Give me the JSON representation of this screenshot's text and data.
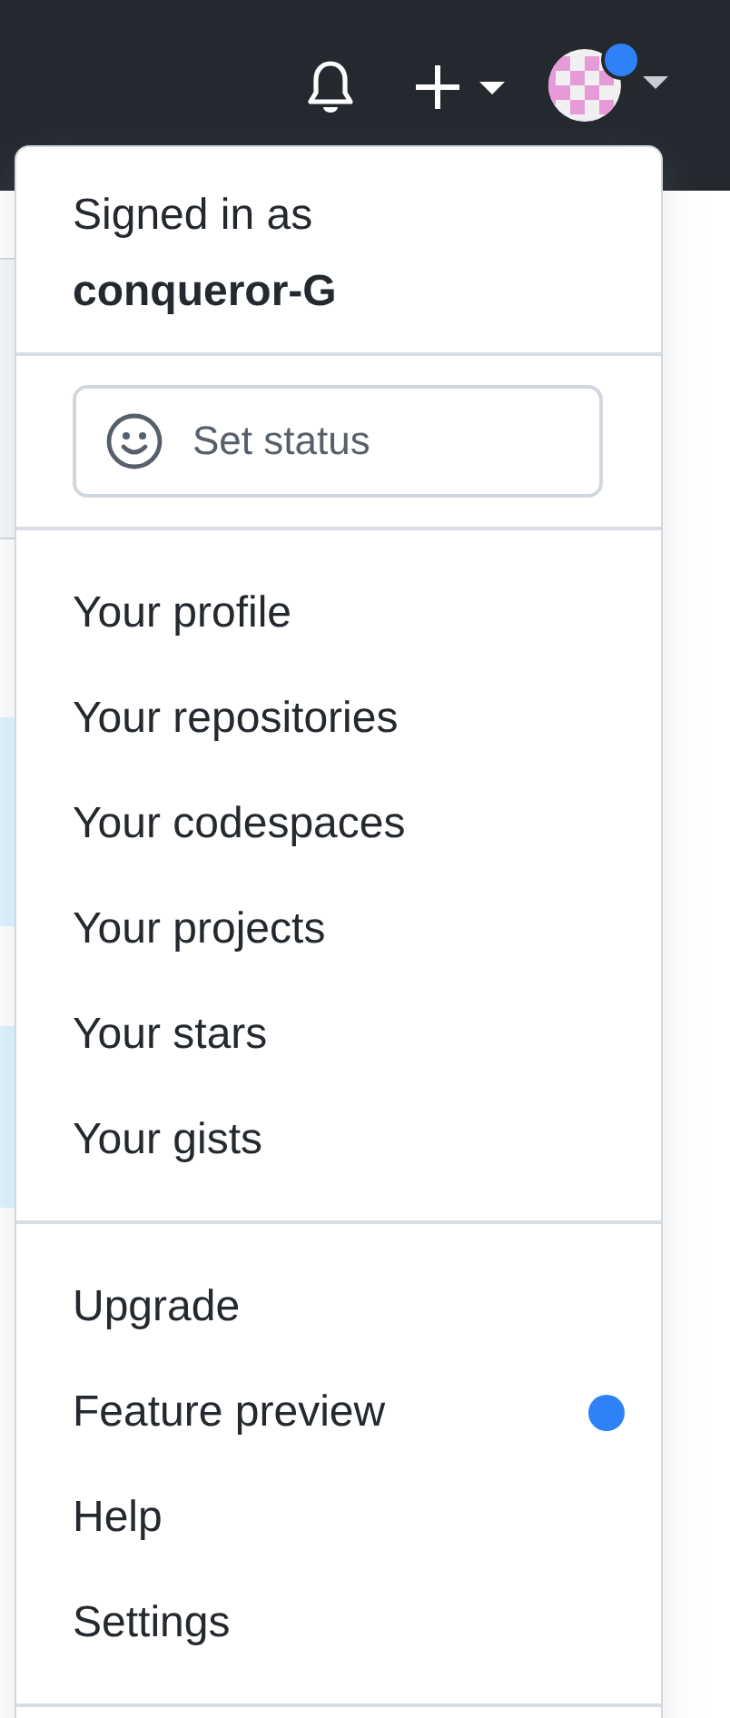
{
  "account_menu": {
    "signed_in_label": "Signed in as",
    "username": "conqueror-G",
    "status_button": "Set status",
    "sections": [
      {
        "items": [
          {
            "label": "Your profile",
            "dot": false
          },
          {
            "label": "Your repositories",
            "dot": false
          },
          {
            "label": "Your codespaces",
            "dot": false
          },
          {
            "label": "Your projects",
            "dot": false
          },
          {
            "label": "Your stars",
            "dot": false
          },
          {
            "label": "Your gists",
            "dot": false
          }
        ]
      },
      {
        "items": [
          {
            "label": "Upgrade",
            "dot": false
          },
          {
            "label": "Feature preview",
            "dot": true
          },
          {
            "label": "Help",
            "dot": false
          },
          {
            "label": "Settings",
            "dot": false
          }
        ]
      }
    ]
  }
}
